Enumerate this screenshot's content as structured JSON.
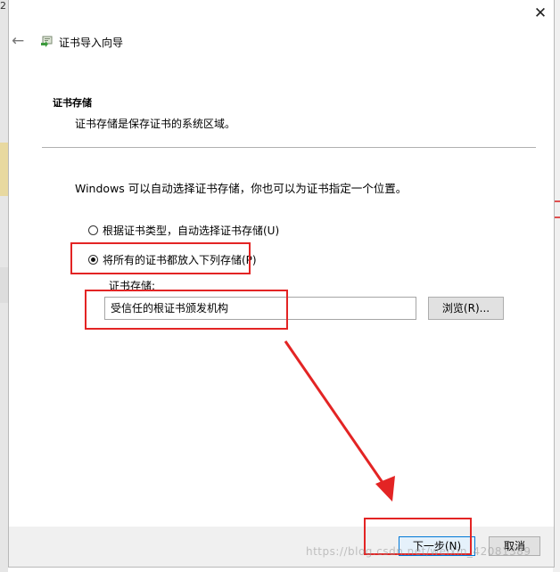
{
  "background": {
    "corner_text": "2"
  },
  "dialog": {
    "title": "证书导入向导",
    "section": {
      "title": "证书存储",
      "description": "证书存储是保存证书的系统区域。"
    },
    "intro": "Windows 可以自动选择证书存储，你也可以为证书指定一个位置。",
    "options": [
      {
        "label": "根据证书类型，自动选择证书存储(U)",
        "selected": false
      },
      {
        "label": "将所有的证书都放入下列存储(P)",
        "selected": true
      }
    ],
    "store": {
      "label": "证书存储:",
      "value": "受信任的根证书颁发机构",
      "browse_label": "浏览(R)..."
    },
    "buttons": {
      "next": "下一步(N)",
      "cancel": "取消"
    }
  },
  "watermark": "https://blog.csdn.net/weixin_42081389",
  "colors": {
    "highlight": "#e32424",
    "accent": "#0078d7"
  }
}
